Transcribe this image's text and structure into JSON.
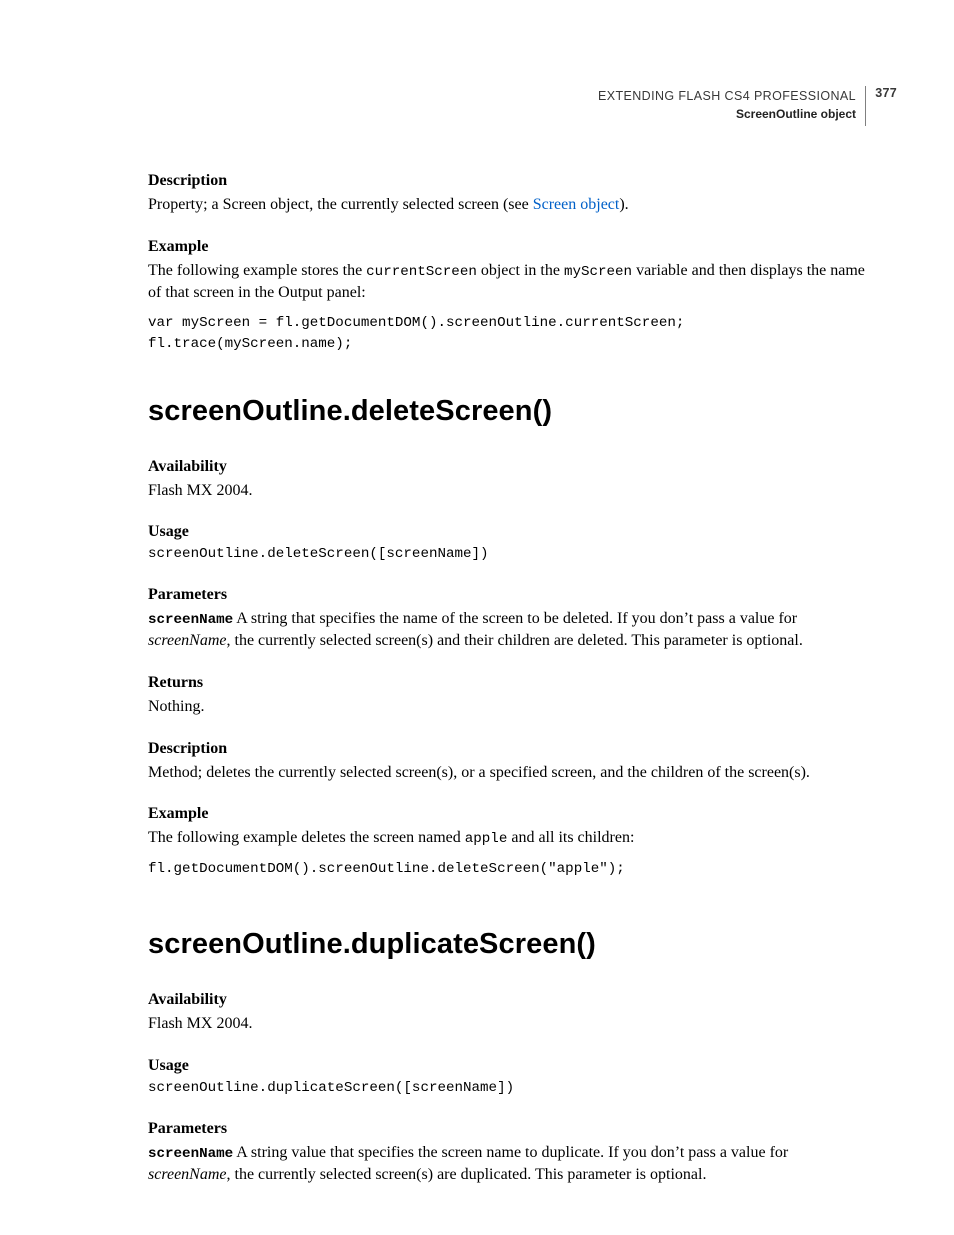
{
  "header": {
    "doc_title": "EXTENDING FLASH CS4 PROFESSIONAL",
    "page_number": "377",
    "section": "ScreenOutline object"
  },
  "sec0": {
    "desc_h": "Description",
    "desc_p_a": "Property; a Screen object, the currently selected screen (see ",
    "desc_link": "Screen object",
    "desc_p_b": ").",
    "ex_h": "Example",
    "ex_p_a": "The following example stores the ",
    "ex_m1": "currentScreen",
    "ex_p_b": " object in the ",
    "ex_m2": "myScreen",
    "ex_p_c": " variable and then displays the name of that screen in the Output panel:",
    "code": "var myScreen = fl.getDocumentDOM().screenOutline.currentScreen;\nfl.trace(myScreen.name);"
  },
  "sec1": {
    "title": "screenOutline.deleteScreen()",
    "avail_h": "Availability",
    "avail_p": "Flash MX 2004.",
    "usage_h": "Usage",
    "usage_code": "screenOutline.deleteScreen([screenName])",
    "params_h": "Parameters",
    "param_name": "screenName",
    "param_p_a": "  A string that specifies the name of the screen to be deleted. If you don’t pass a value for ",
    "param_it": "screenName",
    "param_p_b": ", the currently selected screen(s) and their children are deleted. This parameter is optional.",
    "returns_h": "Returns",
    "returns_p": "Nothing.",
    "desc_h": "Description",
    "desc_p": "Method; deletes the currently selected screen(s), or a specified screen, and the children of the screen(s).",
    "ex_h": "Example",
    "ex_p_a": "The following example deletes the screen named ",
    "ex_m1": "apple",
    "ex_p_b": " and all its children:",
    "ex_code": "fl.getDocumentDOM().screenOutline.deleteScreen(\"apple\");"
  },
  "sec2": {
    "title": "screenOutline.duplicateScreen()",
    "avail_h": "Availability",
    "avail_p": "Flash MX 2004.",
    "usage_h": "Usage",
    "usage_code": "screenOutline.duplicateScreen([screenName])",
    "params_h": "Parameters",
    "param_name": "screenName",
    "param_p_a": "  A string value that specifies the screen name to duplicate. If you don’t pass a value for ",
    "param_it": "screenName",
    "param_p_b": ", the currently selected screen(s) are duplicated. This parameter is optional."
  }
}
